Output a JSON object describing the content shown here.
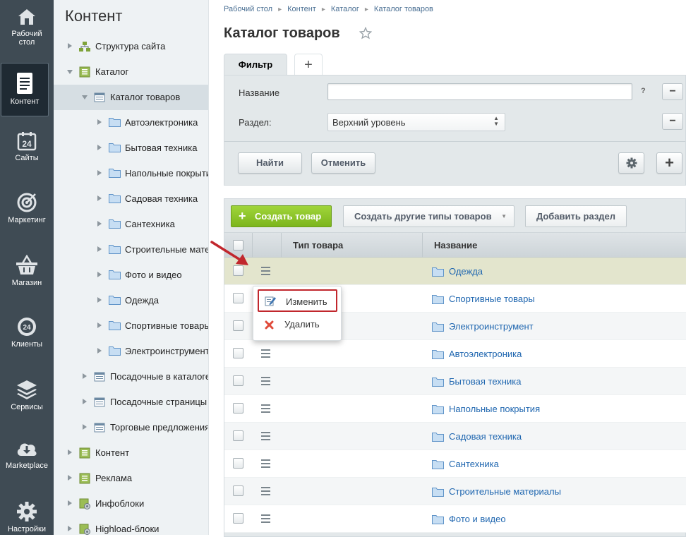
{
  "sidebar": {
    "items": [
      {
        "label_1": "Рабочий",
        "label_2": "стол",
        "icon": "home-icon"
      },
      {
        "label_1": "Контент",
        "label_2": "",
        "icon": "document-icon"
      },
      {
        "label_1": "Сайты",
        "label_2": "",
        "icon": "calendar-24-icon"
      },
      {
        "label_1": "Маркетинг",
        "label_2": "",
        "icon": "target-icon"
      },
      {
        "label_1": "Магазин",
        "label_2": "",
        "icon": "basket-icon"
      },
      {
        "label_1": "Клиенты",
        "label_2": "",
        "icon": "clients-24-icon"
      },
      {
        "label_1": "Сервисы",
        "label_2": "",
        "icon": "layers-icon"
      },
      {
        "label_1": "Marketplace",
        "label_2": "",
        "icon": "cloud-download-icon"
      },
      {
        "label_1": "Настройки",
        "label_2": "",
        "icon": "gear-icon"
      }
    ],
    "icon_24": "24"
  },
  "tree": {
    "title": "Контент",
    "nodes": [
      {
        "label": "Структура сайта"
      },
      {
        "label": "Каталог"
      },
      {
        "label": "Каталог товаров"
      },
      {
        "label": "Автоэлектроника"
      },
      {
        "label": "Бытовая техника"
      },
      {
        "label": "Напольные покрытия"
      },
      {
        "label": "Садовая техника"
      },
      {
        "label": "Сантехника"
      },
      {
        "label": "Строительные материалы"
      },
      {
        "label": "Фото и видео"
      },
      {
        "label": "Одежда"
      },
      {
        "label": "Спортивные товары"
      },
      {
        "label": "Электроинструменты"
      },
      {
        "label": "Посадочные в каталоге"
      },
      {
        "label": "Посадочные страницы"
      },
      {
        "label": "Торговые предложения"
      },
      {
        "label": "Контент"
      },
      {
        "label": "Реклама"
      },
      {
        "label": "Инфоблоки"
      },
      {
        "label": "Highload-блоки"
      }
    ]
  },
  "breadcrumb": [
    "Рабочий стол",
    "Контент",
    "Каталог",
    "Каталог товаров"
  ],
  "page": {
    "title": "Каталог товаров"
  },
  "filter": {
    "tab_label": "Фильтр",
    "add_tab_label": "+",
    "name_label": "Название",
    "name_value": "",
    "help": "?",
    "section_label": "Раздел:",
    "section_value": "Верхний уровень",
    "minus": "−",
    "find_label": "Найти",
    "cancel_label": "Отменить",
    "plus": "+"
  },
  "toolbar": {
    "create_label": "Создать товар",
    "create_other_label": "Создать другие типы товаров",
    "add_section_label": "Добавить раздел"
  },
  "grid": {
    "col_type": "Тип товара",
    "col_name": "Название",
    "rows": [
      {
        "name": "Одежда"
      },
      {
        "name": "Спортивные товары"
      },
      {
        "name": "Электроинструмент"
      },
      {
        "name": "Автоэлектроника"
      },
      {
        "name": "Бытовая техника"
      },
      {
        "name": "Напольные покрытия"
      },
      {
        "name": "Садовая техника"
      },
      {
        "name": "Сантехника"
      },
      {
        "name": "Строительные материалы"
      },
      {
        "name": "Фото и видео"
      }
    ]
  },
  "context_menu": {
    "edit_label": "Изменить",
    "delete_label": "Удалить"
  },
  "colors": {
    "sidebar_bg": "#3f4b54",
    "accent_green": "#8cc22a",
    "link_blue": "#2067b0",
    "annotation_red": "#c1272d"
  }
}
